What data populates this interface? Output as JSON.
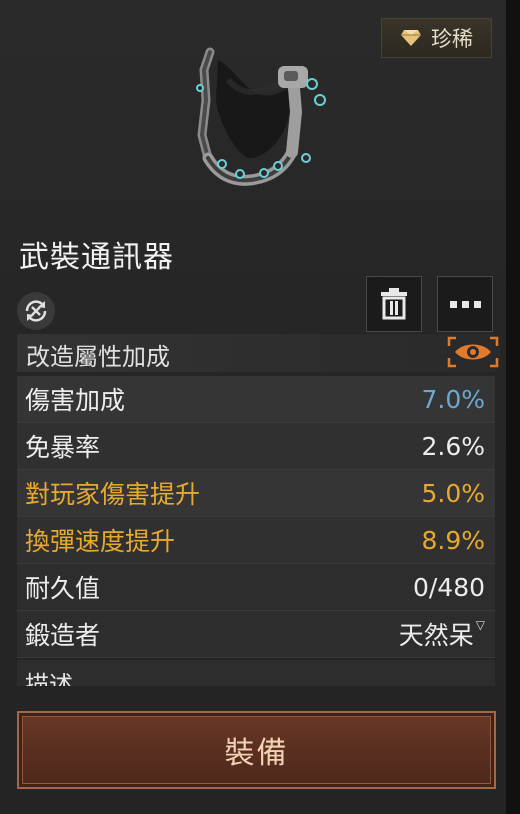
{
  "rarity": {
    "label": "珍稀",
    "icon": "diamond-icon",
    "color": "#d8b36a"
  },
  "item": {
    "name": "武裝通訊器"
  },
  "actions": {
    "unbind_icon": "cancel-cycle-icon",
    "trash_icon": "trash-icon",
    "more_icon": "more-icon"
  },
  "section": {
    "title": "改造屬性加成",
    "eye_icon": "eye-icon",
    "accent": "#e07a2c"
  },
  "stats": [
    {
      "label": "傷害加成",
      "value": "7.0%"
    },
    {
      "label": "免暴率",
      "value": "2.6%"
    },
    {
      "label": "對玩家傷害提升",
      "value": "5.0%"
    },
    {
      "label": "換彈速度提升",
      "value": "8.9%"
    }
  ],
  "info": [
    {
      "label": "耐久值",
      "value": "0/480"
    },
    {
      "label": "鍛造者",
      "value": "天然呆"
    }
  ],
  "description": {
    "title": "描述"
  },
  "equip_button": {
    "label": "裝備"
  },
  "colors": {
    "blue": "#6aa9d2",
    "gold": "#e8a92f",
    "button": "#5a2f20"
  }
}
